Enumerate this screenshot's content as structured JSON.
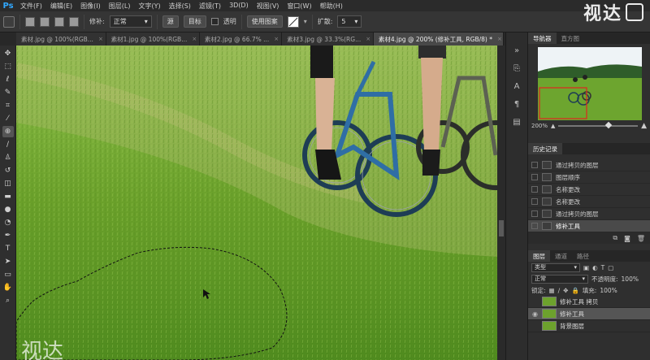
{
  "app": {
    "logo": "Ps"
  },
  "menu": [
    "文件(F)",
    "编辑(E)",
    "图像(I)",
    "图层(L)",
    "文字(Y)",
    "选择(S)",
    "滤镜(T)",
    "3D(D)",
    "视图(V)",
    "窗口(W)",
    "帮助(H)"
  ],
  "watermark": {
    "text": "视达"
  },
  "options": {
    "patch_label": "修补:",
    "patch_mode": "正常",
    "source_label": "源",
    "target_label": "目标",
    "transparent_label": "透明",
    "use_pattern_label": "使用图案",
    "diffusion_label": "扩散:",
    "diffusion_value": "5"
  },
  "doc_tabs": [
    {
      "label": "素材.jpg @ 100%(RGB...",
      "active": false
    },
    {
      "label": "素材1.jpg @ 100%(RGB...",
      "active": false
    },
    {
      "label": "素材2.jpg @ 66.7% ...",
      "active": false
    },
    {
      "label": "素材3.jpg @ 33.3%(RG...",
      "active": false
    },
    {
      "label": "素材4.jpg @ 200% (修补工具, RGB/8) *",
      "active": true
    }
  ],
  "navigator": {
    "tab_active": "导航器",
    "tab_other": "直方图",
    "zoom": "200%"
  },
  "history": {
    "title": "历史记录",
    "items": [
      {
        "label": "通过拷贝的图层",
        "active": false
      },
      {
        "label": "图层顺序",
        "active": false
      },
      {
        "label": "名称更改",
        "active": false
      },
      {
        "label": "名称更改",
        "active": false
      },
      {
        "label": "通过拷贝的图层",
        "active": false
      },
      {
        "label": "修补工具",
        "active": true
      }
    ]
  },
  "layers": {
    "tabs": [
      "图层",
      "通道",
      "路径"
    ],
    "kind_label": "类型",
    "blend_mode": "正常",
    "opacity_label": "不透明度:",
    "opacity_value": "100%",
    "lock_label": "锁定:",
    "fill_label": "填充:",
    "fill_value": "100%",
    "items": [
      {
        "name": "修补工具 拷贝",
        "active": false
      },
      {
        "name": "修补工具",
        "active": true
      },
      {
        "name": "背景图层",
        "active": false
      }
    ]
  },
  "colors": {
    "accent": "#31a8ff",
    "grass": "#6aa02a"
  }
}
